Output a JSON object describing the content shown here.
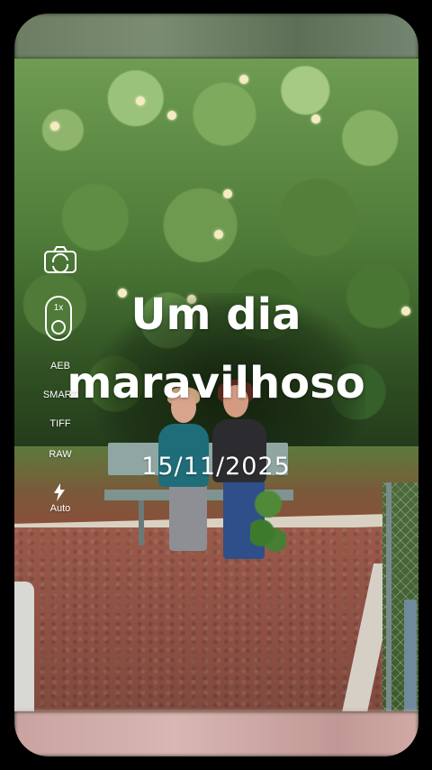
{
  "overlay": {
    "title_line1": "Um dia",
    "title_line2": "maravilhoso",
    "date": "15/11/2025"
  },
  "camera_controls": {
    "camera_icon": "camera-icon",
    "zoom_label": "1x",
    "aeb_label": "AEB",
    "smart_label": "SMART",
    "tiff_label": "TIFF",
    "raw_label": "RAW",
    "flash_icon": "flash-icon",
    "flash_label": "Auto"
  },
  "colors": {
    "background": "#000000",
    "overlay_text": "#ffffff"
  }
}
